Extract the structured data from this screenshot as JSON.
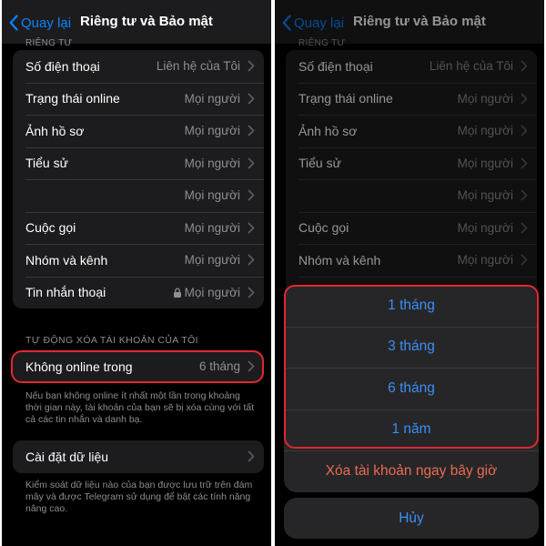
{
  "colors": {
    "accent": "#0a84ff",
    "danger": "#ec6a52",
    "highlight": "#e0282e"
  },
  "nav": {
    "back_label": "Quay lại",
    "title": "Riêng tư và Bảo mật"
  },
  "privacy": {
    "section_title": "RIÊNG TƯ",
    "items": [
      {
        "label": "Số điện thoại",
        "value": "Liên hệ của Tôi"
      },
      {
        "label": "Trạng thái online",
        "value": "Mọi người"
      },
      {
        "label": "Ảnh hồ sơ",
        "value": "Mọi người"
      },
      {
        "label": "Tiểu sử",
        "value": "Mọi người"
      },
      {
        "label": "",
        "value": "Mọi người"
      },
      {
        "label": "Cuộc gọi",
        "value": "Mọi người"
      },
      {
        "label": "Nhóm và kênh",
        "value": "Mọi người"
      },
      {
        "label": "Tin nhắn thoại",
        "value": "Mọi người",
        "icon": "lock-icon"
      }
    ]
  },
  "auto_delete": {
    "header": "TỰ ĐỘNG XÓA TÀI KHOẢN CỦA TÔI",
    "label": "Không online trong",
    "value": "6 tháng",
    "footnote": "Nếu bạn không online ít nhất một lần trong khoảng thời gian này, tài khoản của bạn sẽ bị xóa cùng với tất cả các tin nhắn và danh bạ."
  },
  "data_settings": {
    "label": "Cài đặt dữ liệu",
    "footnote": "Kiểm soát dữ liệu nào của bạn được lưu trữ trên đám mây và được Telegram sử dụng để bật các tính năng nâng cao."
  },
  "action_sheet": {
    "options": [
      "1 tháng",
      "3 tháng",
      "6 tháng",
      "1 năm"
    ],
    "delete_now": "Xóa tài khoản ngay bây giờ",
    "cancel": "Hủy"
  }
}
